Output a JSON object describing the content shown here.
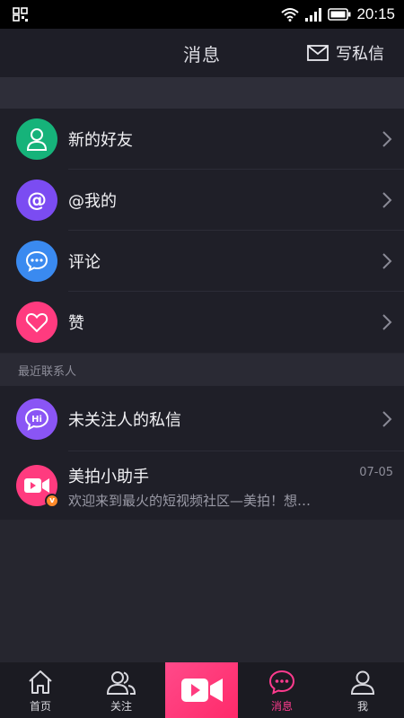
{
  "status_bar": {
    "time": "20:15"
  },
  "header": {
    "title": "消息",
    "compose_label": "写私信"
  },
  "menu": {
    "items": [
      {
        "label": "新的好友",
        "icon": "person-icon",
        "color": "#16b37a"
      },
      {
        "label": "@我的",
        "icon": "at-icon",
        "color": "#7b4cf2"
      },
      {
        "label": "评论",
        "icon": "comment-icon",
        "color": "#3a8af0"
      },
      {
        "label": "赞",
        "icon": "heart-icon",
        "color": "#ff3b7f"
      }
    ]
  },
  "recent": {
    "section_title": "最近联系人",
    "unfollowed": {
      "label": "未关注人的私信",
      "icon_text": "Hi",
      "color": "#8a55f5"
    },
    "assistant": {
      "name": "美拍小助手",
      "preview": "欢迎来到最火的短视频社区—美拍！想…",
      "date": "07-05",
      "color": "#ff3b7f",
      "badge_color": "#ff8a2a",
      "badge_text": "v"
    }
  },
  "tabs": [
    {
      "label": "首页",
      "icon": "home-icon"
    },
    {
      "label": "关注",
      "icon": "users-icon"
    },
    {
      "label": "",
      "icon": "video-camera-icon"
    },
    {
      "label": "消息",
      "icon": "chat-bubble-icon",
      "active": true
    },
    {
      "label": "我",
      "icon": "person-icon"
    }
  ],
  "colors": {
    "accent": "#ff3b8e",
    "background": "#26262f"
  }
}
